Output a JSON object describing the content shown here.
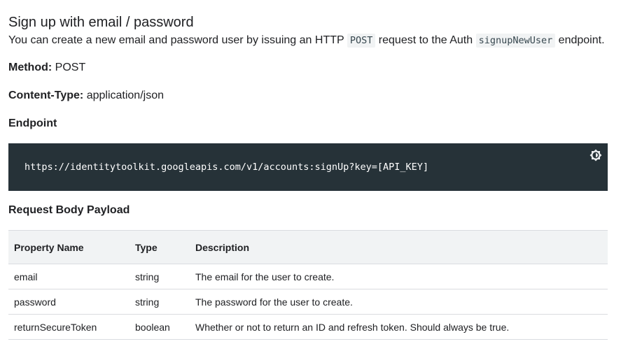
{
  "heading": "Sign up with email / password",
  "intro": {
    "text_before": "You can create a new email and password user by issuing an HTTP ",
    "method_code": "POST",
    "text_middle": " request to the Auth ",
    "endpoint_code": "signupNewUser",
    "text_after": " endpoint."
  },
  "method": {
    "label": "Method:",
    "value": " POST"
  },
  "content_type": {
    "label": "Content-Type:",
    "value": " application/json"
  },
  "endpoint": {
    "label": "Endpoint",
    "url": "https://identitytoolkit.googleapis.com/v1/accounts:signUp?key=[API_KEY]"
  },
  "payload": {
    "label": "Request Body Payload",
    "columns": [
      "Property Name",
      "Type",
      "Description"
    ],
    "rows": [
      [
        "email",
        "string",
        "The email for the user to create."
      ],
      [
        "password",
        "string",
        "The password for the user to create."
      ],
      [
        "returnSecureToken",
        "boolean",
        "Whether or not to return an ID and refresh token. Should always be true."
      ]
    ]
  },
  "icons": {
    "code_theme": "brightness-icon"
  },
  "colors": {
    "code_background": "#263238",
    "inline_code_background": "#f1f3f4",
    "table_header_background": "#f1f3f4",
    "text": "#202124"
  }
}
